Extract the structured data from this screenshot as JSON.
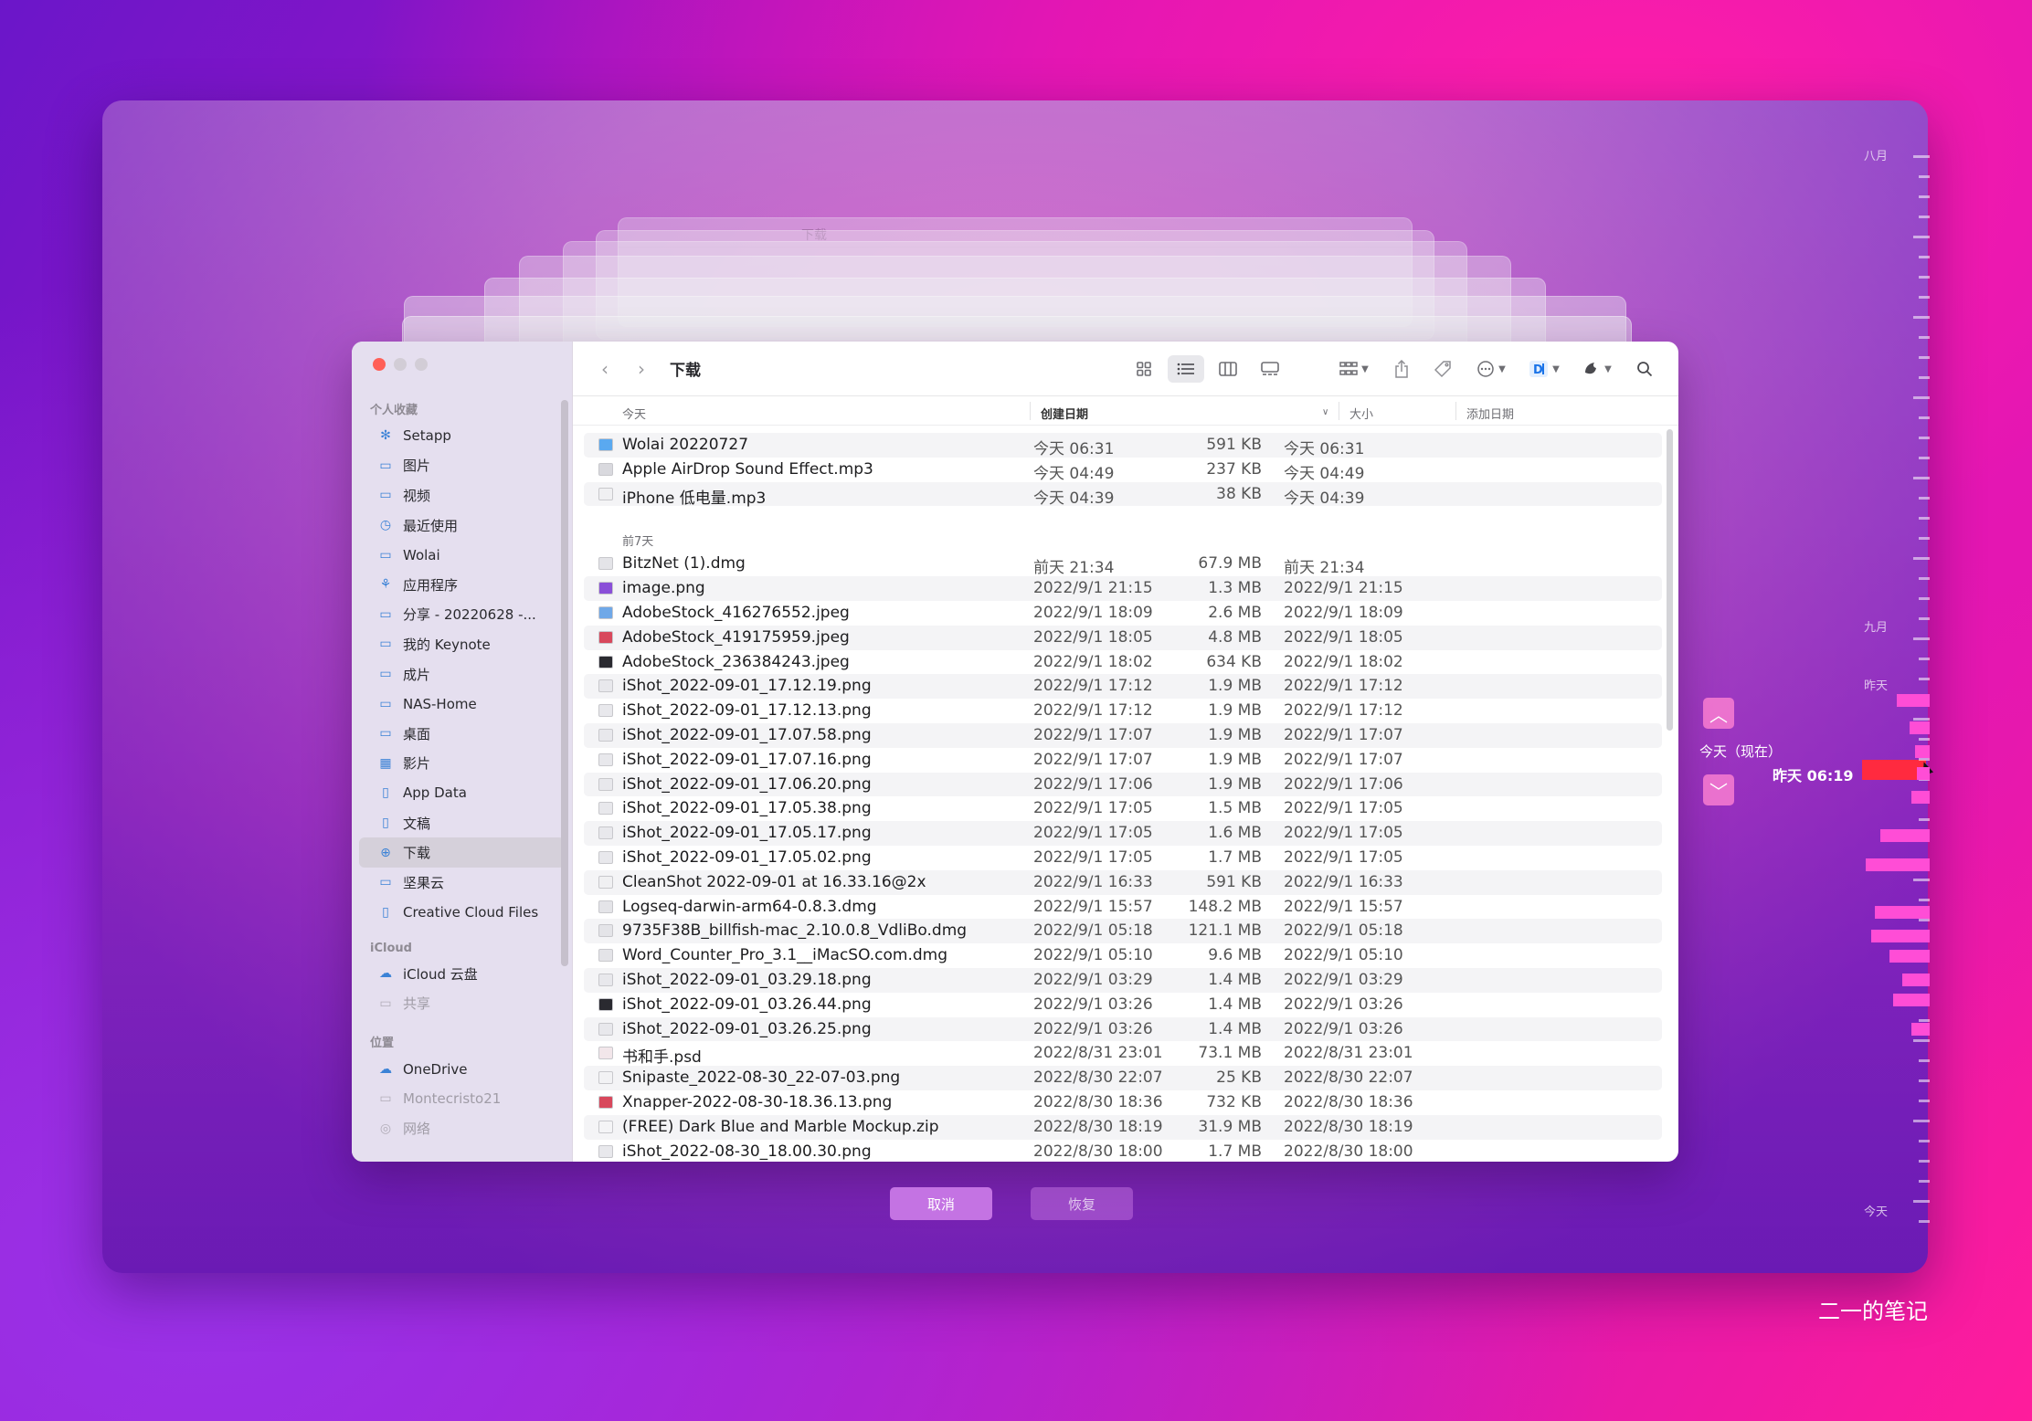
{
  "window": {
    "title": "下载",
    "nav_back": "‹",
    "nav_forward": "›"
  },
  "sidebar": {
    "sections": [
      {
        "title": "个人收藏",
        "items": [
          {
            "label": "Setapp",
            "icon": "setapp-icon"
          },
          {
            "label": "图片",
            "icon": "folder-icon"
          },
          {
            "label": "视频",
            "icon": "folder-icon"
          },
          {
            "label": "最近使用",
            "icon": "clock-icon"
          },
          {
            "label": "Wolai",
            "icon": "folder-icon"
          },
          {
            "label": "应用程序",
            "icon": "apps-icon"
          },
          {
            "label": "分享 - 20220628 -...",
            "icon": "folder-icon"
          },
          {
            "label": "我的 Keynote",
            "icon": "folder-icon"
          },
          {
            "label": "成片",
            "icon": "folder-icon"
          },
          {
            "label": "NAS-Home",
            "icon": "folder-icon"
          },
          {
            "label": "桌面",
            "icon": "desktop-icon"
          },
          {
            "label": "影片",
            "icon": "film-icon"
          },
          {
            "label": "App Data",
            "icon": "doc-icon"
          },
          {
            "label": "文稿",
            "icon": "doc-icon"
          },
          {
            "label": "下载",
            "icon": "download-icon",
            "active": true
          },
          {
            "label": "坚果云",
            "icon": "folder-icon"
          },
          {
            "label": "Creative Cloud Files",
            "icon": "doc-icon"
          }
        ]
      },
      {
        "title": "iCloud",
        "items": [
          {
            "label": "iCloud 云盘",
            "icon": "cloud-icon"
          },
          {
            "label": "共享",
            "icon": "shared-folder-icon",
            "dim": true
          }
        ]
      },
      {
        "title": "位置",
        "items": [
          {
            "label": "OneDrive",
            "icon": "cloud-icon"
          },
          {
            "label": "Montecristo21",
            "icon": "computer-icon",
            "dim": true
          },
          {
            "label": "网络",
            "icon": "globe-icon",
            "dim": true
          }
        ]
      }
    ]
  },
  "columns": {
    "name": "今天",
    "created": "创建日期",
    "size": "大小",
    "added": "添加日期"
  },
  "groups": [
    {
      "label": "今天",
      "rows": [
        {
          "name": "Wolai 20220727",
          "created": "今天 06:31",
          "size": "591 KB",
          "added": "今天 06:31",
          "type": "folder"
        },
        {
          "name": "Apple AirDrop Sound Effect.mp3",
          "created": "今天 04:49",
          "size": "237 KB",
          "added": "今天 04:49",
          "type": "audio"
        },
        {
          "name": "iPhone 低电量.mp3",
          "created": "今天 04:39",
          "size": "38 KB",
          "added": "今天 04:39",
          "type": "doc"
        }
      ]
    },
    {
      "label": "前7天",
      "rows": [
        {
          "name": "BitzNet (1).dmg",
          "created": "前天 21:34",
          "size": "67.9 MB",
          "added": "前天 21:34",
          "type": "dmg"
        },
        {
          "name": "image.png",
          "created": "2022/9/1 21:15",
          "size": "1.3 MB",
          "added": "2022/9/1 21:15",
          "type": "image-purple"
        },
        {
          "name": "AdobeStock_416276552.jpeg",
          "created": "2022/9/1 18:09",
          "size": "2.6 MB",
          "added": "2022/9/1 18:09",
          "type": "image-blue"
        },
        {
          "name": "AdobeStock_419175959.jpeg",
          "created": "2022/9/1 18:05",
          "size": "4.8 MB",
          "added": "2022/9/1 18:05",
          "type": "image-red"
        },
        {
          "name": "AdobeStock_236384243.jpeg",
          "created": "2022/9/1 18:02",
          "size": "634 KB",
          "added": "2022/9/1 18:02",
          "type": "image-dark"
        },
        {
          "name": "iShot_2022-09-01_17.12.19.png",
          "created": "2022/9/1 17:12",
          "size": "1.9 MB",
          "added": "2022/9/1 17:12",
          "type": "png"
        },
        {
          "name": "iShot_2022-09-01_17.12.13.png",
          "created": "2022/9/1 17:12",
          "size": "1.9 MB",
          "added": "2022/9/1 17:12",
          "type": "png"
        },
        {
          "name": "iShot_2022-09-01_17.07.58.png",
          "created": "2022/9/1 17:07",
          "size": "1.9 MB",
          "added": "2022/9/1 17:07",
          "type": "png"
        },
        {
          "name": "iShot_2022-09-01_17.07.16.png",
          "created": "2022/9/1 17:07",
          "size": "1.9 MB",
          "added": "2022/9/1 17:07",
          "type": "png"
        },
        {
          "name": "iShot_2022-09-01_17.06.20.png",
          "created": "2022/9/1 17:06",
          "size": "1.9 MB",
          "added": "2022/9/1 17:06",
          "type": "png"
        },
        {
          "name": "iShot_2022-09-01_17.05.38.png",
          "created": "2022/9/1 17:05",
          "size": "1.5 MB",
          "added": "2022/9/1 17:05",
          "type": "png"
        },
        {
          "name": "iShot_2022-09-01_17.05.17.png",
          "created": "2022/9/1 17:05",
          "size": "1.6 MB",
          "added": "2022/9/1 17:05",
          "type": "png"
        },
        {
          "name": "iShot_2022-09-01_17.05.02.png",
          "created": "2022/9/1 17:05",
          "size": "1.7 MB",
          "added": "2022/9/1 17:05",
          "type": "png"
        },
        {
          "name": "CleanShot 2022-09-01 at 16.33.16@2x",
          "created": "2022/9/1 16:33",
          "size": "591 KB",
          "added": "2022/9/1 16:33",
          "type": "doc"
        },
        {
          "name": "Logseq-darwin-arm64-0.8.3.dmg",
          "created": "2022/9/1 15:57",
          "size": "148.2 MB",
          "added": "2022/9/1 15:57",
          "type": "dmg"
        },
        {
          "name": "9735F38B_billfish-mac_2.10.0.8_VdliBo.dmg",
          "created": "2022/9/1 05:18",
          "size": "121.1 MB",
          "added": "2022/9/1 05:18",
          "type": "dmg"
        },
        {
          "name": "Word_Counter_Pro_3.1__iMacSO.com.dmg",
          "created": "2022/9/1 05:10",
          "size": "9.6 MB",
          "added": "2022/9/1 05:10",
          "type": "dmg"
        },
        {
          "name": "iShot_2022-09-01_03.29.18.png",
          "created": "2022/9/1 03:29",
          "size": "1.4 MB",
          "added": "2022/9/1 03:29",
          "type": "png"
        },
        {
          "name": "iShot_2022-09-01_03.26.44.png",
          "created": "2022/9/1 03:26",
          "size": "1.4 MB",
          "added": "2022/9/1 03:26",
          "type": "image-dark"
        },
        {
          "name": "iShot_2022-09-01_03.26.25.png",
          "created": "2022/9/1 03:26",
          "size": "1.4 MB",
          "added": "2022/9/1 03:26",
          "type": "png"
        },
        {
          "name": "书和手.psd",
          "created": "2022/8/31 23:01",
          "size": "73.1 MB",
          "added": "2022/8/31 23:01",
          "type": "psd"
        },
        {
          "name": "Snipaste_2022-08-30_22-07-03.png",
          "created": "2022/8/30 22:07",
          "size": "25 KB",
          "added": "2022/8/30 22:07",
          "type": "png-thin"
        },
        {
          "name": "Xnapper-2022-08-30-18.36.13.png",
          "created": "2022/8/30 18:36",
          "size": "732 KB",
          "added": "2022/8/30 18:36",
          "type": "image-red"
        },
        {
          "name": "(FREE) Dark Blue and Marble Mockup.zip",
          "created": "2022/8/30 18:19",
          "size": "31.9 MB",
          "added": "2022/8/30 18:19",
          "type": "zip"
        },
        {
          "name": "iShot_2022-08-30_18.00.30.png",
          "created": "2022/8/30 18:00",
          "size": "1.7 MB",
          "added": "2022/8/30 18:00",
          "type": "png"
        }
      ]
    }
  ],
  "buttons": {
    "cancel": "取消",
    "restore": "恢复"
  },
  "timeline": {
    "labels": [
      {
        "text": "八月"
      },
      {
        "text": "九月"
      },
      {
        "text": "昨天"
      },
      {
        "text": "今天"
      }
    ],
    "now_label": "今天（现在）",
    "current_time": "昨天 06:19",
    "up_arrow": "︿",
    "down_arrow": "﹀"
  },
  "ghost_window_title": "下载",
  "watermark": "二一的笔记",
  "colors": {
    "accent_red": "#ff2a3f",
    "timeline_pink": "#ff4dd6",
    "folder_blue": "#3b82d6"
  }
}
